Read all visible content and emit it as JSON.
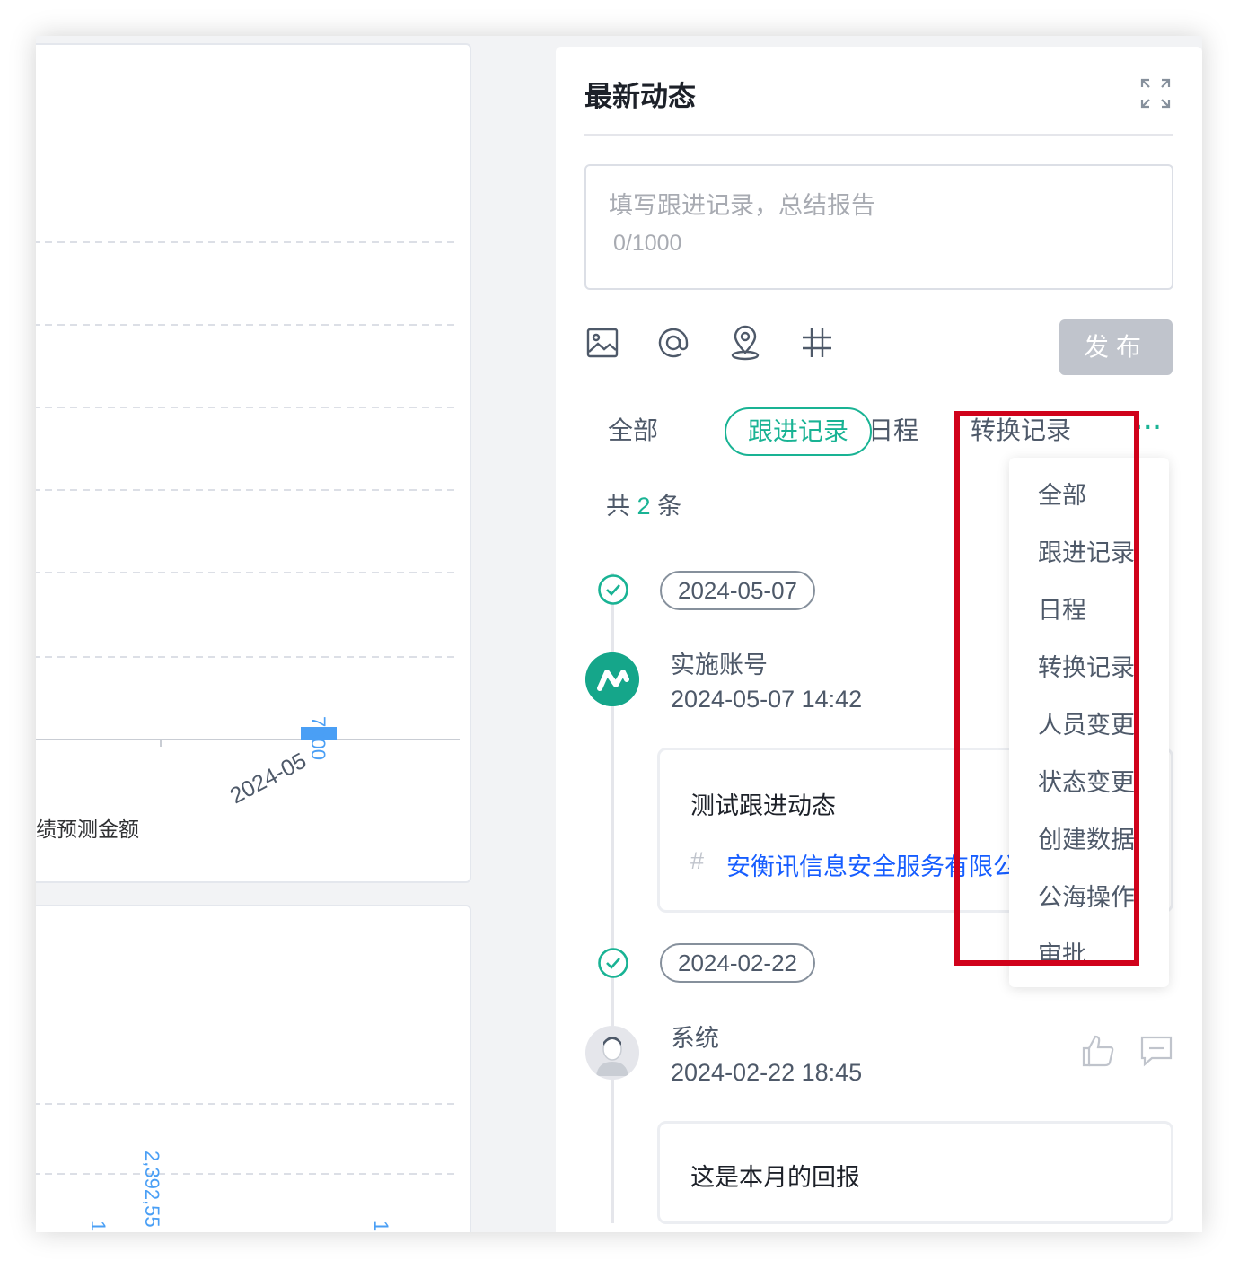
{
  "left_cards": {
    "chart1": {
      "bar_value": "7000",
      "x_label": "2024-05",
      "legend_text": "绩预测金额"
    },
    "chart2": {
      "data_labels": [
        "1,",
        "2,392,55",
        "1,"
      ]
    }
  },
  "panel": {
    "title": "最新动态",
    "editor": {
      "placeholder": "填写跟进记录，总结报告",
      "char_count": "0/1000"
    },
    "toolbar": {
      "icons": [
        "image-icon",
        "at-icon",
        "location-icon",
        "hashtag-icon"
      ],
      "publish_label": "发布"
    },
    "tabs": [
      {
        "label": "全部",
        "active": false
      },
      {
        "label": "跟进记录",
        "active": true
      },
      {
        "label": "日程",
        "active": false
      },
      {
        "label": "转换记录",
        "active": false
      }
    ],
    "more_label": "···",
    "total": {
      "prefix": "共",
      "count": "2",
      "suffix": "条"
    },
    "timeline": [
      {
        "date": "2024-05-07",
        "user": "实施账号",
        "time": "2024-05-07 14:42",
        "content": "测试跟进动态",
        "hash_symbol": "#",
        "link": "安衡讯信息安全服务有限公"
      },
      {
        "date": "2024-02-22",
        "user": "系统",
        "time": "2024-02-22 18:45",
        "content": "这是本月的回报"
      }
    ]
  },
  "dropdown": {
    "items": [
      "全部",
      "跟进记录",
      "日程",
      "转换记录",
      "人员变更",
      "状态变更",
      "创建数据",
      "公海操作",
      "审批"
    ]
  },
  "colors": {
    "accent": "#19b394",
    "link": "#165dff",
    "highlight": "#d0021b",
    "bar": "#4a9ff5"
  }
}
